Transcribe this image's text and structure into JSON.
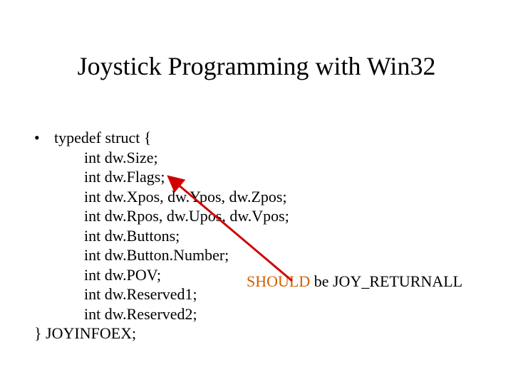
{
  "title": "Joystick Programming with Win32",
  "bullet_marker": "•",
  "struct": {
    "line_open": "typedef struct {",
    "members": [
      "int dw.Size;",
      "int dw.Flags;",
      "int dw.Xpos, dw.Ypos, dw.Zpos;",
      "int dw.Rpos, dw.Upos, dw.Vpos;",
      "int dw.Buttons;",
      "int dw.Button.Number;",
      "int dw.POV;",
      "int dw.Reserved1;",
      "int dw.Reserved2;"
    ],
    "line_close": "} JOYINFOEX;"
  },
  "annotation": {
    "should_word": "SHOULD",
    "rest": " be JOY_RETURNALL"
  },
  "colors": {
    "should": "#d06000",
    "arrow": "#d00000"
  }
}
